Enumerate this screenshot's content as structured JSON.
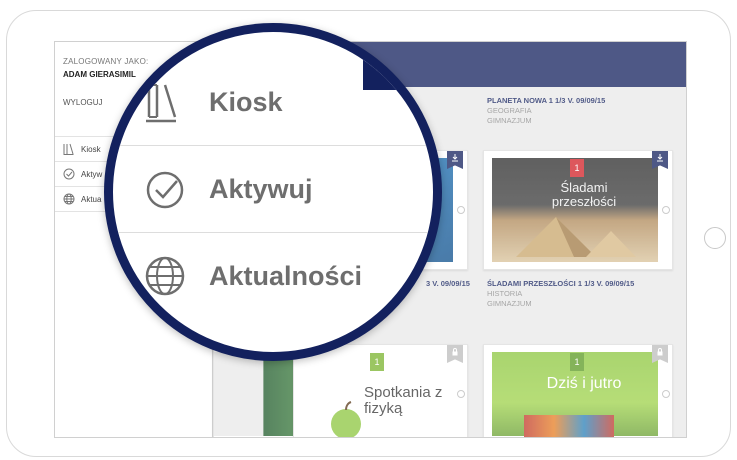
{
  "sidebar": {
    "logged_in_label": "ZALOGOWANY JAKO:",
    "user_name": "ADAM GIERASIMIL",
    "logout": "WYLOGUJ",
    "items": [
      {
        "label": "Kiosk",
        "icon": "books-icon"
      },
      {
        "label": "Aktyw",
        "icon": "check-circle-icon"
      },
      {
        "label": "Aktua",
        "icon": "globe-icon"
      }
    ]
  },
  "magnifier": {
    "items": [
      {
        "label": "Kiosk",
        "icon": "books-icon"
      },
      {
        "label": "Aktywuj",
        "icon": "check-circle-icon"
      },
      {
        "label": "Aktualności",
        "icon": "globe-icon"
      }
    ]
  },
  "books": [
    {
      "title": "PLANETA NOWA 1 1/3 V. 09/09/15",
      "subject": "GEOGRAFIA",
      "level": "GIMNAZJUM"
    },
    {
      "title": "ŚLADAMI PRZESZŁOŚCI 1 1/3 V. 09/09/15",
      "subject": "HISTORIA",
      "level": "GIMNAZJUM",
      "cover_text": "Śladami przeszłości",
      "badge": "1"
    },
    {
      "title_fragment": "3 V. 09/09/15"
    },
    {
      "cover_text": "Spotkania z fizyką",
      "badge": "1"
    },
    {
      "cover_text": "Dziś i jutro",
      "badge": "1"
    }
  ],
  "colors": {
    "navy": "#13215e",
    "red": "#d21f26",
    "green": "#7ab32e"
  }
}
